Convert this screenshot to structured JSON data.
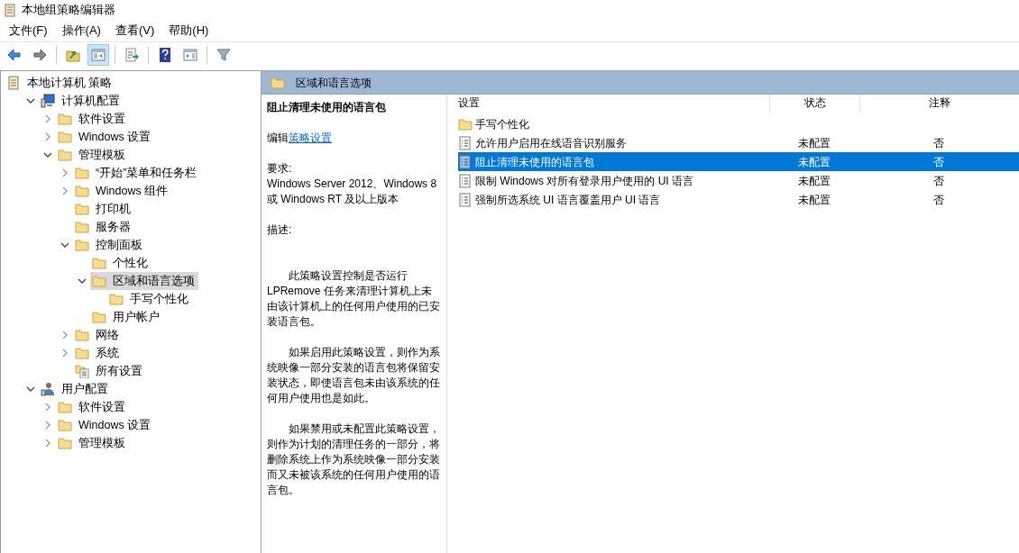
{
  "window": {
    "title": "本地组策略编辑器"
  },
  "menu": [
    "文件(F)",
    "操作(A)",
    "查看(V)",
    "帮助(H)"
  ],
  "toolbar": [
    {
      "kind": "back",
      "selected": false
    },
    {
      "kind": "forward",
      "selected": false
    },
    {
      "kind": "sep"
    },
    {
      "kind": "up",
      "selected": false
    },
    {
      "kind": "pane",
      "selected": true
    },
    {
      "kind": "sep"
    },
    {
      "kind": "export",
      "selected": false
    },
    {
      "kind": "sep"
    },
    {
      "kind": "help",
      "selected": false
    },
    {
      "kind": "view",
      "selected": false
    },
    {
      "kind": "sep"
    },
    {
      "kind": "filter",
      "selected": false
    }
  ],
  "tree": [
    {
      "label": "本地计算机 策略",
      "kind": "policy",
      "selected": false,
      "children": [
        {
          "label": "计算机配置",
          "kind": "computer",
          "expanded": true,
          "selected": false,
          "children": [
            {
              "label": "软件设置",
              "kind": "folder",
              "expanded": false,
              "selected": false
            },
            {
              "label": "Windows 设置",
              "kind": "folder",
              "expanded": false,
              "selected": false
            },
            {
              "label": "管理模板",
              "kind": "folder",
              "expanded": true,
              "selected": false,
              "children": [
                {
                  "label": "“开始”菜单和任务栏",
                  "kind": "folder",
                  "expanded": false,
                  "selected": false
                },
                {
                  "label": "Windows 组件",
                  "kind": "folder",
                  "expanded": false,
                  "selected": false
                },
                {
                  "label": "打印机",
                  "kind": "folder",
                  "selected": false
                },
                {
                  "label": "服务器",
                  "kind": "folder",
                  "selected": false
                },
                {
                  "label": "控制面板",
                  "kind": "folder",
                  "expanded": true,
                  "selected": false,
                  "children": [
                    {
                      "label": "个性化",
                      "kind": "folder",
                      "selected": false
                    },
                    {
                      "label": "区域和语言选项",
                      "kind": "folder",
                      "expanded": true,
                      "selected": true,
                      "children": [
                        {
                          "label": "手写个性化",
                          "kind": "folder",
                          "selected": false
                        }
                      ]
                    },
                    {
                      "label": "用户帐户",
                      "kind": "folder",
                      "selected": false
                    }
                  ]
                },
                {
                  "label": "网络",
                  "kind": "folder",
                  "expanded": false,
                  "selected": false
                },
                {
                  "label": "系统",
                  "kind": "folder",
                  "expanded": false,
                  "selected": false
                },
                {
                  "label": "所有设置",
                  "kind": "settings",
                  "selected": false
                }
              ]
            }
          ]
        },
        {
          "label": "用户配置",
          "kind": "user",
          "expanded": true,
          "selected": false,
          "children": [
            {
              "label": "软件设置",
              "kind": "folder",
              "expanded": false,
              "selected": false
            },
            {
              "label": "Windows 设置",
              "kind": "folder",
              "expanded": false,
              "selected": false
            },
            {
              "label": "管理模板",
              "kind": "folder",
              "expanded": false,
              "selected": false
            }
          ]
        }
      ]
    }
  ],
  "header": {
    "title": "区域和语言选项"
  },
  "description": {
    "title": "阻止清理未使用的语言包",
    "edit_prefix": "编辑",
    "edit_link": "策略设置",
    "requirements_label": "要求:",
    "requirements": "Windows Server 2012、Windows 8 或 Windows RT 及以上版本",
    "description_label": "描述:",
    "paragraphs": [
      "此策略设置控制是否运行 LPRemove 任务来清理计算机上未由该计算机上的任何用户使用的已安装语言包。",
      "如果启用此策略设置，则作为系统映像一部分安装的语言包将保留安装状态，即使语言包未由该系统的任何用户使用也是如此。",
      "如果禁用或未配置此策略设置，则作为计划的清理任务的一部分，将删除系统上作为系统映像一部分安装而又未被该系统的任何用户使用的语言包。"
    ]
  },
  "table": {
    "columns": [
      "设置",
      "状态",
      "注释"
    ],
    "rows": [
      {
        "kind": "folder",
        "setting": "手写个性化",
        "selected": false
      },
      {
        "kind": "policy",
        "setting": "允许用户启用在线语音识别服务",
        "state": "未配置",
        "comment": "否",
        "selected": false
      },
      {
        "kind": "policy",
        "setting": "阻止清理未使用的语言包",
        "state": "未配置",
        "comment": "否",
        "selected": true
      },
      {
        "kind": "policy",
        "setting": "限制 Windows 对所有登录用户使用的 UI 语言",
        "state": "未配置",
        "comment": "否",
        "selected": false
      },
      {
        "kind": "policy",
        "setting": "强制所选系统 UI 语言覆盖用户 UI 语言",
        "state": "未配置",
        "comment": "否",
        "selected": false
      }
    ]
  }
}
